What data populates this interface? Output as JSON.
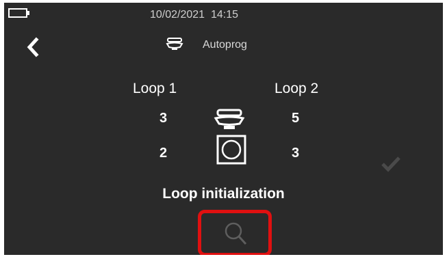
{
  "status_bar": {
    "datetime": "10/02/2021  14:15",
    "battery_icon": "battery-icon"
  },
  "header": {
    "title": "Autoprog",
    "back_icon": "chevron-left-icon",
    "title_icon": "detector-icon"
  },
  "loops": {
    "loop1": {
      "label": "Loop 1",
      "detectors": "3",
      "modules": "2"
    },
    "loop2": {
      "label": "Loop 2",
      "detectors": "5",
      "modules": "3"
    }
  },
  "status": {
    "text": "Loop initialization"
  },
  "actions": {
    "search_icon": "search-icon",
    "confirm_icon": "checkmark-icon"
  },
  "colors": {
    "background": "#2a2a2a",
    "highlight": "#e01010",
    "text": "#ffffff"
  }
}
